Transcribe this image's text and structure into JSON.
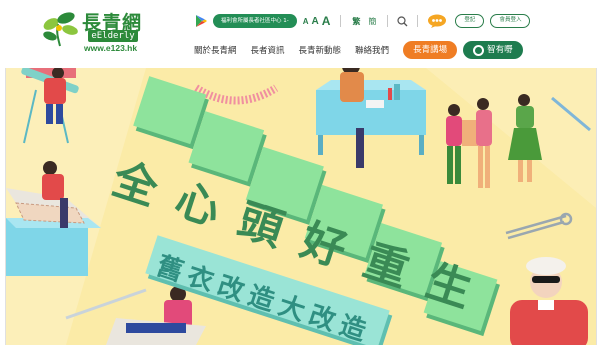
{
  "logo": {
    "name_cn": "長青網",
    "name_en": "eElderly",
    "url": "www.e123.hk"
  },
  "topbar": {
    "app_icon": "google-play-icon",
    "centre_label": "福利會所屬長者社區中心 1-",
    "font_small": "A",
    "font_medium": "A",
    "font_large": "A",
    "lang_traditional": "繁",
    "lang_simplified": "簡",
    "search_icon": "search-icon",
    "chat_icon": "chat-bubble-icon",
    "register_label": "登記",
    "login_label": "會員登入"
  },
  "nav": {
    "items": [
      "關於長青網",
      "長者資訊",
      "長青新動態",
      "聯絡我們"
    ],
    "talk_label": "長青講場",
    "wisdom_label": "智有嘢"
  },
  "banner": {
    "headline": "全心頭好重生",
    "subheadline": "舊衣改造大改造",
    "colors": {
      "background": "#fbeba7",
      "headline_green": "#7ed88c",
      "subheadline_teal": "#7fd6c8"
    }
  }
}
